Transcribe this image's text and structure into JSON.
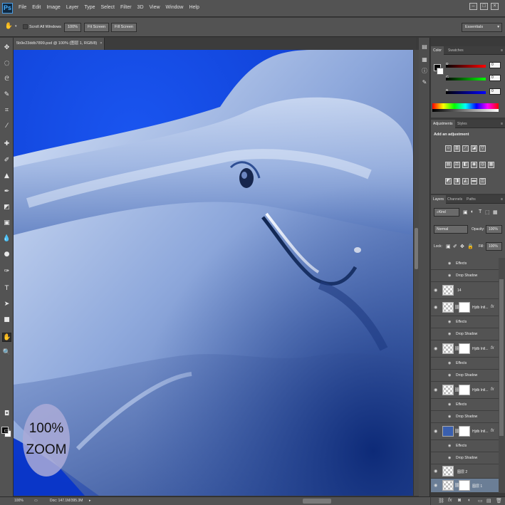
{
  "app": {
    "logo": "Ps",
    "menus": [
      "File",
      "Edit",
      "Image",
      "Layer",
      "Type",
      "Select",
      "Filter",
      "3D",
      "View",
      "Window",
      "Help"
    ],
    "window_controls": [
      "–",
      "□",
      "×"
    ]
  },
  "options_bar": {
    "scroll_all_windows": "Scroll All Windows",
    "btn_100": "100%",
    "btn_fit_screen": "Fit Screen",
    "btn_fill_screen": "Fill Screen",
    "workspace": "Essentials"
  },
  "document": {
    "tab_title": "5b9e23ddb7899.psd @ 100% (图层 1, RGB/8)",
    "tab_close": "×",
    "zoom_badge_line1": "100%",
    "zoom_badge_line2": "ZOOM"
  },
  "status_bar": {
    "zoom": "100%",
    "doc": "Doc: 147.1M/395.3M"
  },
  "color_panel": {
    "tabs": [
      "Color",
      "Swatches"
    ],
    "channels": [
      {
        "label": "R",
        "value": "0",
        "color": "#e01010"
      },
      {
        "label": "G",
        "value": "0",
        "color": "#10c010"
      },
      {
        "label": "B",
        "value": "0",
        "color": "#1030e0"
      }
    ]
  },
  "adjustments_panel": {
    "tabs": [
      "Adjustments",
      "Styles"
    ],
    "title": "Add an adjustment"
  },
  "layers_panel": {
    "tabs": [
      "Layers",
      "Channels",
      "Paths"
    ],
    "kind_filter": "Kind",
    "blend_mode": "Normal",
    "opacity_label": "Opacity:",
    "opacity_value": "100%",
    "lock_label": "Lock:",
    "fill_label": "Fill:",
    "fill_value": "100%",
    "rows": [
      {
        "type": "effect",
        "name": "Effects"
      },
      {
        "type": "effect",
        "name": "Drop Shadow"
      },
      {
        "type": "layer",
        "name": "14",
        "mask": false
      },
      {
        "type": "layer",
        "name": "Hjdb Intl...",
        "mask": true
      },
      {
        "type": "effect",
        "name": "Effects"
      },
      {
        "type": "effect",
        "name": "Drop Shadow"
      },
      {
        "type": "layer",
        "name": "Hjdb Intl...",
        "mask": true
      },
      {
        "type": "effect",
        "name": "Effects"
      },
      {
        "type": "effect",
        "name": "Drop Shadow"
      },
      {
        "type": "layer",
        "name": "Hjdb Intl...",
        "mask": true
      },
      {
        "type": "effect",
        "name": "Effects"
      },
      {
        "type": "effect",
        "name": "Drop Shadow"
      },
      {
        "type": "layer",
        "name": "Hjdb Intl...",
        "mask": true
      },
      {
        "type": "effect",
        "name": "Effects"
      },
      {
        "type": "effect",
        "name": "Drop Shadow"
      },
      {
        "type": "layer",
        "name": "图层 2",
        "mask": false
      },
      {
        "type": "layer",
        "name": "图层 1",
        "mask": true,
        "selected": true
      }
    ]
  }
}
